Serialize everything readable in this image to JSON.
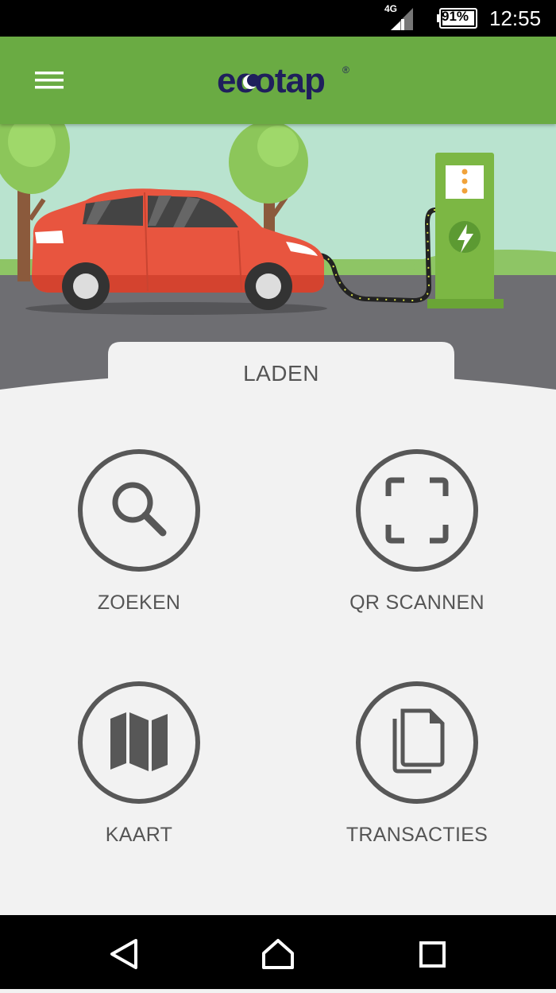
{
  "status_bar": {
    "network": "4G",
    "battery": "91%",
    "time": "12:55"
  },
  "app_bar": {
    "logo": "ecotap",
    "logo_mark": "®"
  },
  "section": {
    "title": "LADEN"
  },
  "actions": [
    {
      "label": "ZOEKEN",
      "icon": "search-icon"
    },
    {
      "label": "QR SCANNEN",
      "icon": "qr-scan-icon"
    },
    {
      "label": "KAART",
      "icon": "map-icon"
    },
    {
      "label": "TRANSACTIES",
      "icon": "documents-icon"
    }
  ],
  "colors": {
    "app_bar": "#6aab43",
    "logo_text": "#1f1f5c",
    "icon_gray": "#575757",
    "car": "#e8553f",
    "charger": "#7cb744",
    "sky": "#b9e3cf",
    "road": "#6e6e72"
  }
}
